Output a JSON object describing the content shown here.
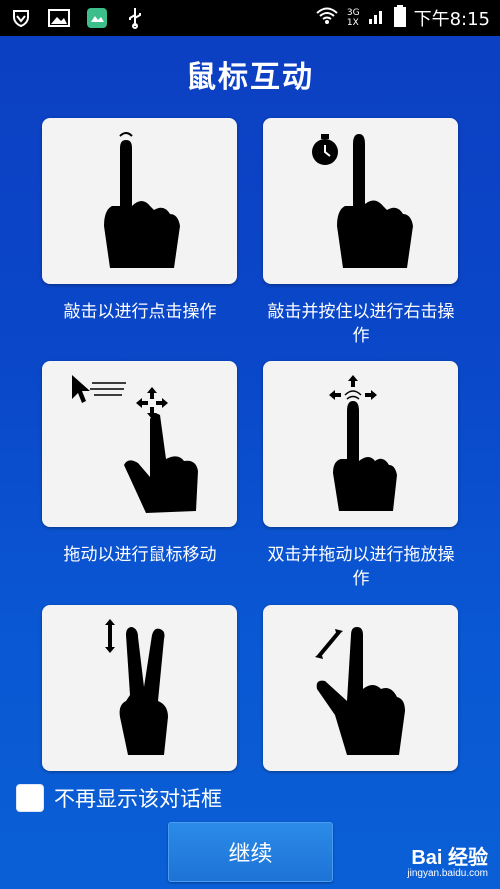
{
  "status_bar": {
    "network_top": "3G",
    "network_bottom": "1X",
    "time": "下午8:15",
    "icons": [
      "shield-icon",
      "gallery-icon",
      "app-icon",
      "usb-icon",
      "wifi-icon",
      "signal-icon",
      "battery-icon"
    ]
  },
  "dialog": {
    "title": "鼠标互动",
    "gestures": [
      {
        "label": "敲击以进行点击操作",
        "icon": "single-tap-gesture-icon"
      },
      {
        "label": "敲击并按住以进行右击操作",
        "icon": "tap-and-hold-gesture-icon"
      },
      {
        "label": "拖动以进行鼠标移动",
        "icon": "drag-move-gesture-icon"
      },
      {
        "label": "双击并拖动以进行拖放操作",
        "icon": "double-tap-drag-gesture-icon"
      },
      {
        "label": "",
        "icon": "two-finger-scroll-gesture-icon"
      },
      {
        "label": "",
        "icon": "pinch-zoom-gesture-icon"
      }
    ],
    "checkbox_label": "不再显示该对话框",
    "checkbox_checked": false,
    "continue_label": "继续"
  },
  "watermark": {
    "brand": "Bai 经验",
    "url": "jingyan.baidu.com"
  }
}
